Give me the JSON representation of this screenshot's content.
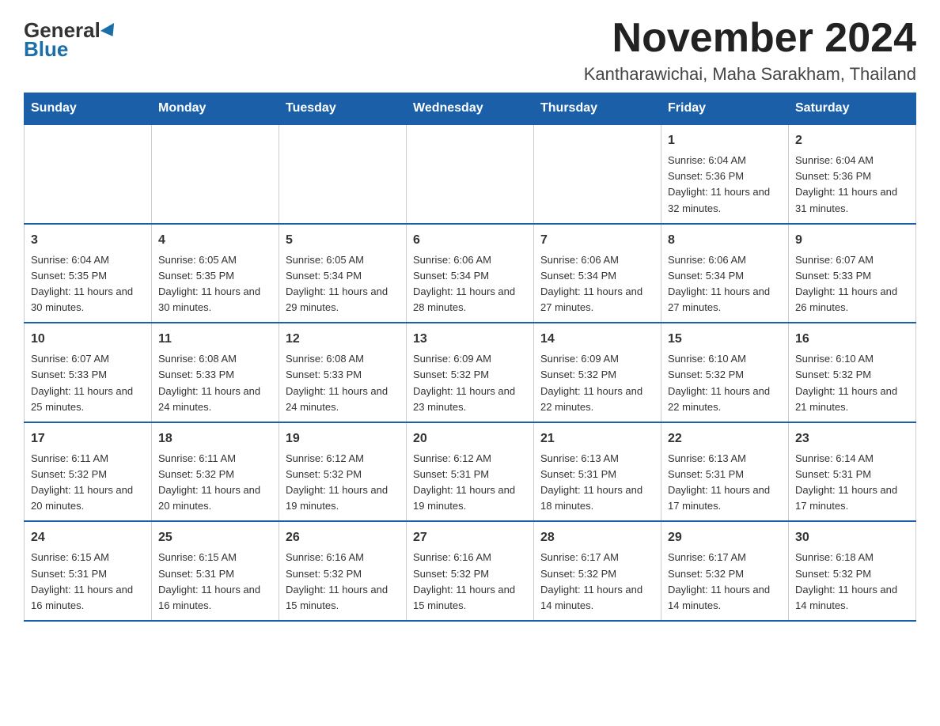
{
  "header": {
    "logo_general": "General",
    "logo_blue": "Blue",
    "month_title": "November 2024",
    "location": "Kantharawichai, Maha Sarakham, Thailand"
  },
  "days_of_week": [
    "Sunday",
    "Monday",
    "Tuesday",
    "Wednesday",
    "Thursday",
    "Friday",
    "Saturday"
  ],
  "weeks": [
    [
      {
        "day": "",
        "info": ""
      },
      {
        "day": "",
        "info": ""
      },
      {
        "day": "",
        "info": ""
      },
      {
        "day": "",
        "info": ""
      },
      {
        "day": "",
        "info": ""
      },
      {
        "day": "1",
        "info": "Sunrise: 6:04 AM\nSunset: 5:36 PM\nDaylight: 11 hours and 32 minutes."
      },
      {
        "day": "2",
        "info": "Sunrise: 6:04 AM\nSunset: 5:36 PM\nDaylight: 11 hours and 31 minutes."
      }
    ],
    [
      {
        "day": "3",
        "info": "Sunrise: 6:04 AM\nSunset: 5:35 PM\nDaylight: 11 hours and 30 minutes."
      },
      {
        "day": "4",
        "info": "Sunrise: 6:05 AM\nSunset: 5:35 PM\nDaylight: 11 hours and 30 minutes."
      },
      {
        "day": "5",
        "info": "Sunrise: 6:05 AM\nSunset: 5:34 PM\nDaylight: 11 hours and 29 minutes."
      },
      {
        "day": "6",
        "info": "Sunrise: 6:06 AM\nSunset: 5:34 PM\nDaylight: 11 hours and 28 minutes."
      },
      {
        "day": "7",
        "info": "Sunrise: 6:06 AM\nSunset: 5:34 PM\nDaylight: 11 hours and 27 minutes."
      },
      {
        "day": "8",
        "info": "Sunrise: 6:06 AM\nSunset: 5:34 PM\nDaylight: 11 hours and 27 minutes."
      },
      {
        "day": "9",
        "info": "Sunrise: 6:07 AM\nSunset: 5:33 PM\nDaylight: 11 hours and 26 minutes."
      }
    ],
    [
      {
        "day": "10",
        "info": "Sunrise: 6:07 AM\nSunset: 5:33 PM\nDaylight: 11 hours and 25 minutes."
      },
      {
        "day": "11",
        "info": "Sunrise: 6:08 AM\nSunset: 5:33 PM\nDaylight: 11 hours and 24 minutes."
      },
      {
        "day": "12",
        "info": "Sunrise: 6:08 AM\nSunset: 5:33 PM\nDaylight: 11 hours and 24 minutes."
      },
      {
        "day": "13",
        "info": "Sunrise: 6:09 AM\nSunset: 5:32 PM\nDaylight: 11 hours and 23 minutes."
      },
      {
        "day": "14",
        "info": "Sunrise: 6:09 AM\nSunset: 5:32 PM\nDaylight: 11 hours and 22 minutes."
      },
      {
        "day": "15",
        "info": "Sunrise: 6:10 AM\nSunset: 5:32 PM\nDaylight: 11 hours and 22 minutes."
      },
      {
        "day": "16",
        "info": "Sunrise: 6:10 AM\nSunset: 5:32 PM\nDaylight: 11 hours and 21 minutes."
      }
    ],
    [
      {
        "day": "17",
        "info": "Sunrise: 6:11 AM\nSunset: 5:32 PM\nDaylight: 11 hours and 20 minutes."
      },
      {
        "day": "18",
        "info": "Sunrise: 6:11 AM\nSunset: 5:32 PM\nDaylight: 11 hours and 20 minutes."
      },
      {
        "day": "19",
        "info": "Sunrise: 6:12 AM\nSunset: 5:32 PM\nDaylight: 11 hours and 19 minutes."
      },
      {
        "day": "20",
        "info": "Sunrise: 6:12 AM\nSunset: 5:31 PM\nDaylight: 11 hours and 19 minutes."
      },
      {
        "day": "21",
        "info": "Sunrise: 6:13 AM\nSunset: 5:31 PM\nDaylight: 11 hours and 18 minutes."
      },
      {
        "day": "22",
        "info": "Sunrise: 6:13 AM\nSunset: 5:31 PM\nDaylight: 11 hours and 17 minutes."
      },
      {
        "day": "23",
        "info": "Sunrise: 6:14 AM\nSunset: 5:31 PM\nDaylight: 11 hours and 17 minutes."
      }
    ],
    [
      {
        "day": "24",
        "info": "Sunrise: 6:15 AM\nSunset: 5:31 PM\nDaylight: 11 hours and 16 minutes."
      },
      {
        "day": "25",
        "info": "Sunrise: 6:15 AM\nSunset: 5:31 PM\nDaylight: 11 hours and 16 minutes."
      },
      {
        "day": "26",
        "info": "Sunrise: 6:16 AM\nSunset: 5:32 PM\nDaylight: 11 hours and 15 minutes."
      },
      {
        "day": "27",
        "info": "Sunrise: 6:16 AM\nSunset: 5:32 PM\nDaylight: 11 hours and 15 minutes."
      },
      {
        "day": "28",
        "info": "Sunrise: 6:17 AM\nSunset: 5:32 PM\nDaylight: 11 hours and 14 minutes."
      },
      {
        "day": "29",
        "info": "Sunrise: 6:17 AM\nSunset: 5:32 PM\nDaylight: 11 hours and 14 minutes."
      },
      {
        "day": "30",
        "info": "Sunrise: 6:18 AM\nSunset: 5:32 PM\nDaylight: 11 hours and 14 minutes."
      }
    ]
  ]
}
